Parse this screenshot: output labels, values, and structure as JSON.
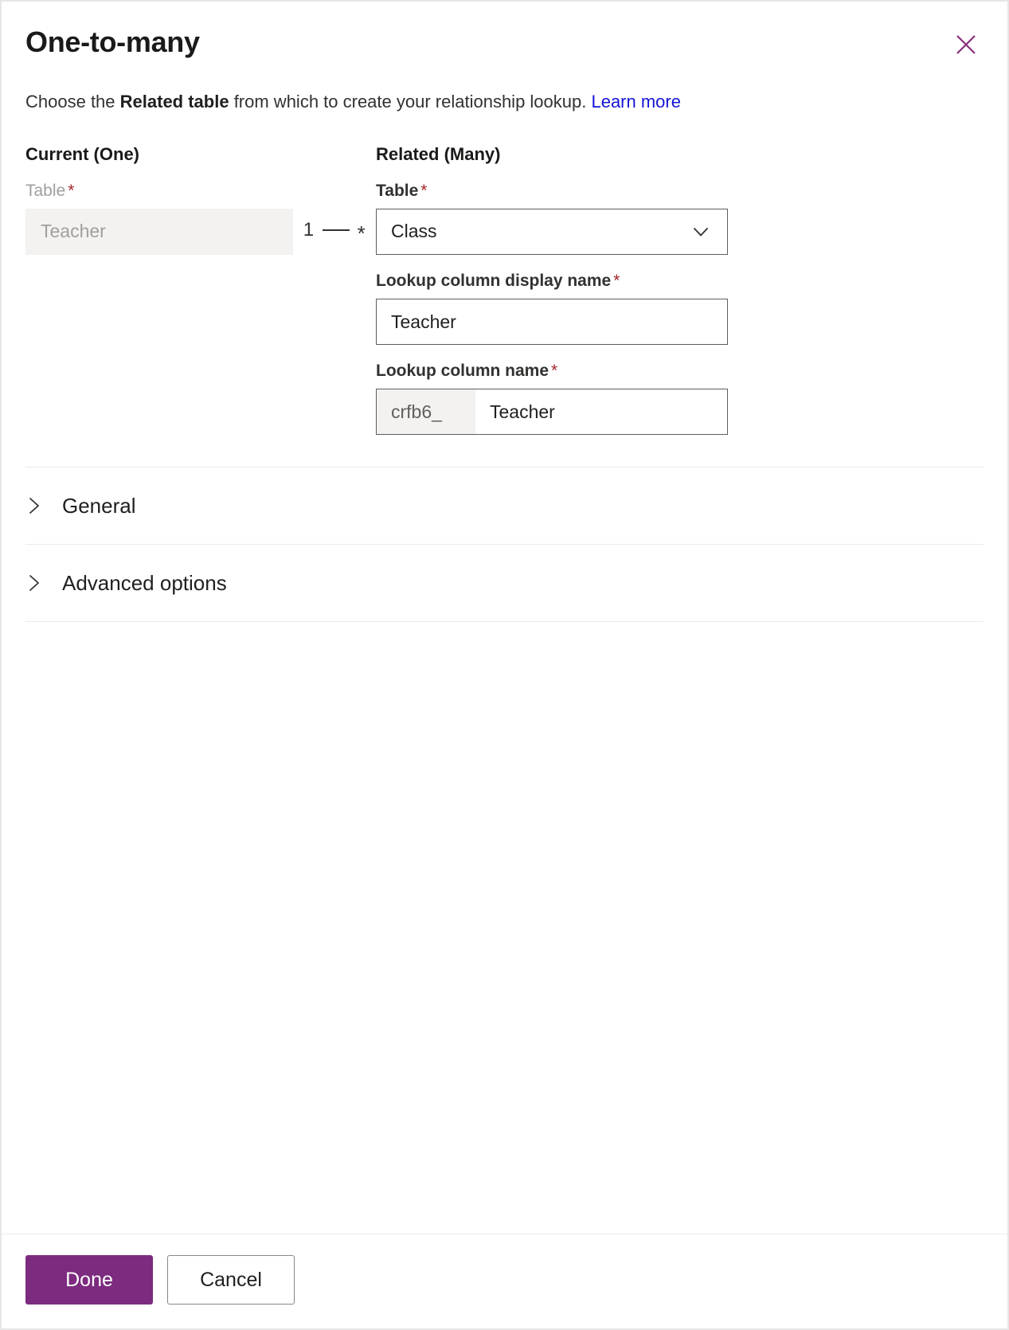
{
  "panel": {
    "title": "One-to-many",
    "close_icon": "close-icon",
    "subtitle": {
      "before": "Choose the ",
      "bold": "Related table",
      "after": " from which to create your relationship lookup. ",
      "link": "Learn more"
    }
  },
  "current": {
    "heading": "Current (One)",
    "table_label": "Table",
    "required_marker": "*",
    "table_value": "Teacher"
  },
  "connector": {
    "one": "1",
    "many": "*"
  },
  "related": {
    "heading": "Related (Many)",
    "table_label": "Table",
    "table_value": "Class",
    "table_chevron_icon": "chevron-down-icon",
    "display_name_label": "Lookup column display name",
    "display_name_value": "Teacher",
    "column_name_label": "Lookup column name",
    "column_name_prefix": "crfb6_",
    "column_name_value": "Teacher",
    "required_marker": "*"
  },
  "sections": [
    {
      "label": "General",
      "icon": "chevron-right-icon",
      "expanded": false
    },
    {
      "label": "Advanced options",
      "icon": "chevron-right-icon",
      "expanded": false
    }
  ],
  "footer": {
    "done_label": "Done",
    "cancel_label": "Cancel"
  },
  "colors": {
    "accent": "#7c2b7f",
    "link": "#1414d6",
    "required": "#a4262c",
    "border": "#605e5c",
    "disabled_bg": "#f3f2f1",
    "divider": "#edebe9"
  }
}
